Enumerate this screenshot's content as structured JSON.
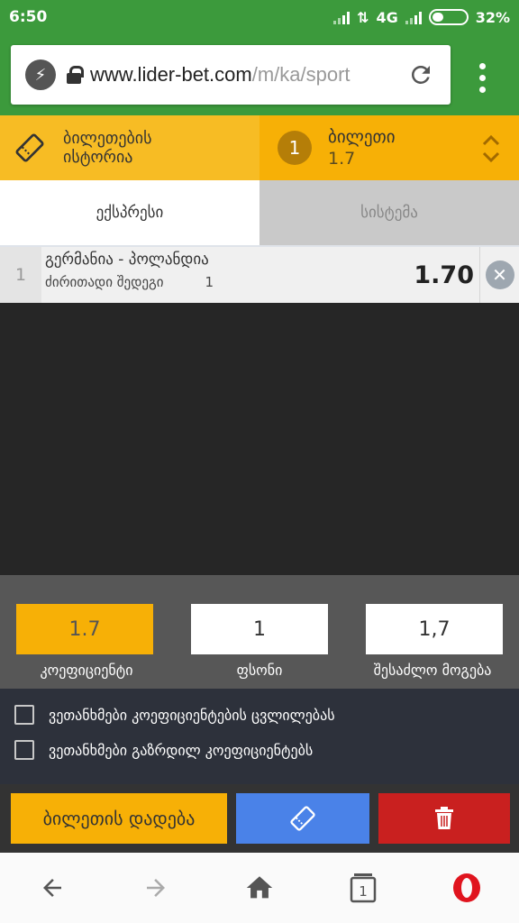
{
  "status_bar": {
    "time": "6:50",
    "network": "4G",
    "battery": "32%"
  },
  "browser": {
    "url_host": "www.lider-bet.com",
    "url_path": "/m/ka/sport"
  },
  "header": {
    "history_label": "ბილეთების ისტორია",
    "ticket_count": "1",
    "ticket_label": "ბილეთი",
    "ticket_odds": "1.7"
  },
  "tabs": {
    "express": "ექსპრესი",
    "system": "სისტემა"
  },
  "bet": {
    "index": "1",
    "match": "გერმანია - პოლანდია",
    "market": "ძირითადი შედეგი",
    "selection": "1",
    "odds": "1.70"
  },
  "stats": {
    "odds_value": "1.7",
    "stake_value": "1",
    "win_value": "1,7",
    "odds_label": "კოეფიციენტი",
    "stake_label": "ფსონი",
    "win_label": "შესაძლო მოგება"
  },
  "agreements": {
    "accept_changes": "ვეთანხმები კოეფიციენტების ცვლილებას",
    "accept_increased": "ვეთანხმები გაზრდილ კოეფიციენტებს"
  },
  "actions": {
    "place_label": "ბილეთის დადება"
  },
  "bottom_nav": {
    "tabs_count": "1"
  },
  "colors": {
    "brand_green": "#3c9a3c",
    "accent_yellow": "#f7b006",
    "ticket_blue": "#4a82e8",
    "delete_red": "#c9201f",
    "opera_red": "#e0141e"
  }
}
